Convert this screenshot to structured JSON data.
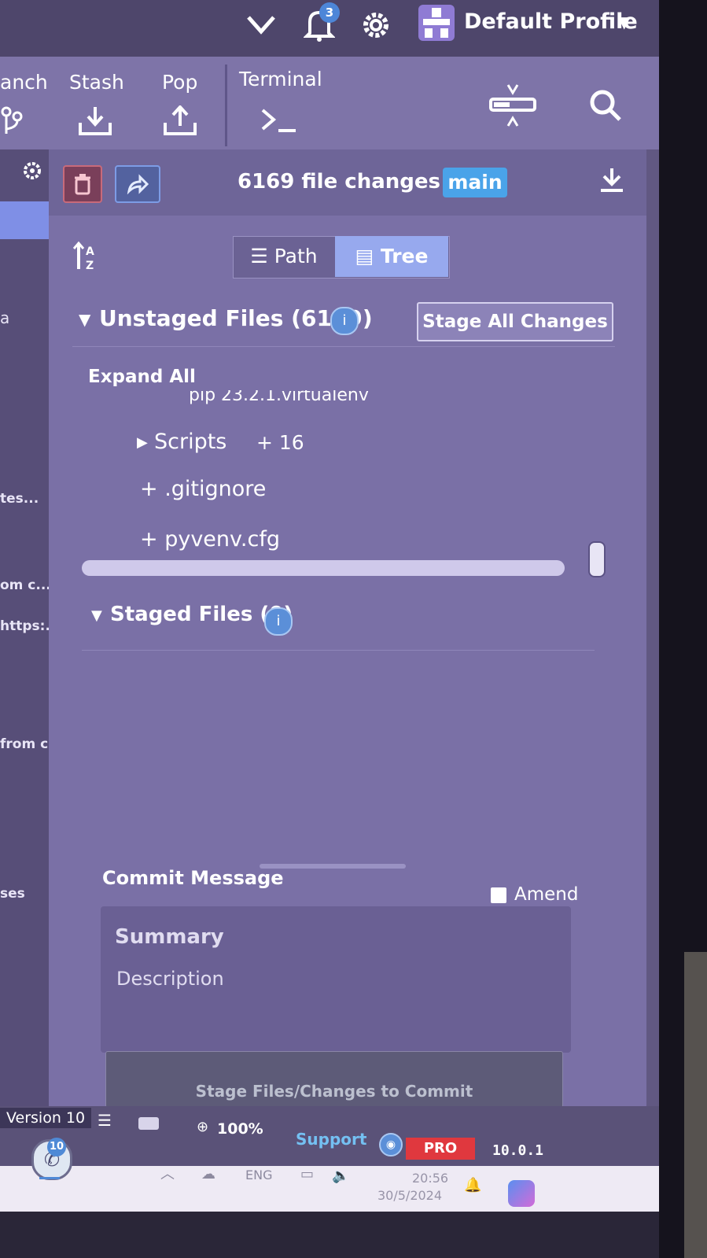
{
  "topbar": {
    "chevron": "chevron-down-icon",
    "notifications_count": "3",
    "profile_name": "Default Profile"
  },
  "toolbar": {
    "branch_label": "anch",
    "stash_label": "Stash",
    "pop_label": "Pop",
    "terminal_label": "Terminal"
  },
  "left_panel": {
    "snippets": [
      "a",
      "tes...",
      "om c...",
      "https:...",
      "from c...",
      "ses"
    ]
  },
  "header": {
    "changes_text": "6169 file changes on",
    "branch": "main"
  },
  "view_toggle": {
    "path_label": "Path",
    "tree_label": "Tree"
  },
  "unstaged": {
    "title": "Unstaged Files (6169)",
    "stage_all_label": "Stage All Changes",
    "expand_all_label": "Expand All",
    "cutoff_row": "pip 23.2.1.virtualenv",
    "folder_name": "Scripts",
    "folder_count": "+ 16",
    "files": [
      "+ .gitignore",
      "+ pyvenv.cfg"
    ]
  },
  "staged": {
    "title": "Staged Files (0)"
  },
  "commit": {
    "label": "Commit Message",
    "amend_label": "Amend",
    "summary_placeholder": "Summary",
    "description_placeholder": "Description",
    "commit_button_label": "Stage Files/Changes to Commit"
  },
  "statusbar": {
    "version_label": "Version 10",
    "zoom": "100%",
    "support_label": "Support",
    "pro_label": "PRO",
    "app_version": "10.0.1"
  },
  "taskbar": {
    "whatsapp_badge": "10",
    "language": "ENG",
    "time": "20:56",
    "date": "30/5/2024"
  },
  "colors": {
    "accent_blue": "#4aa3e9",
    "pro_red": "#e0383e",
    "panel_bg": "#7a70a6"
  }
}
